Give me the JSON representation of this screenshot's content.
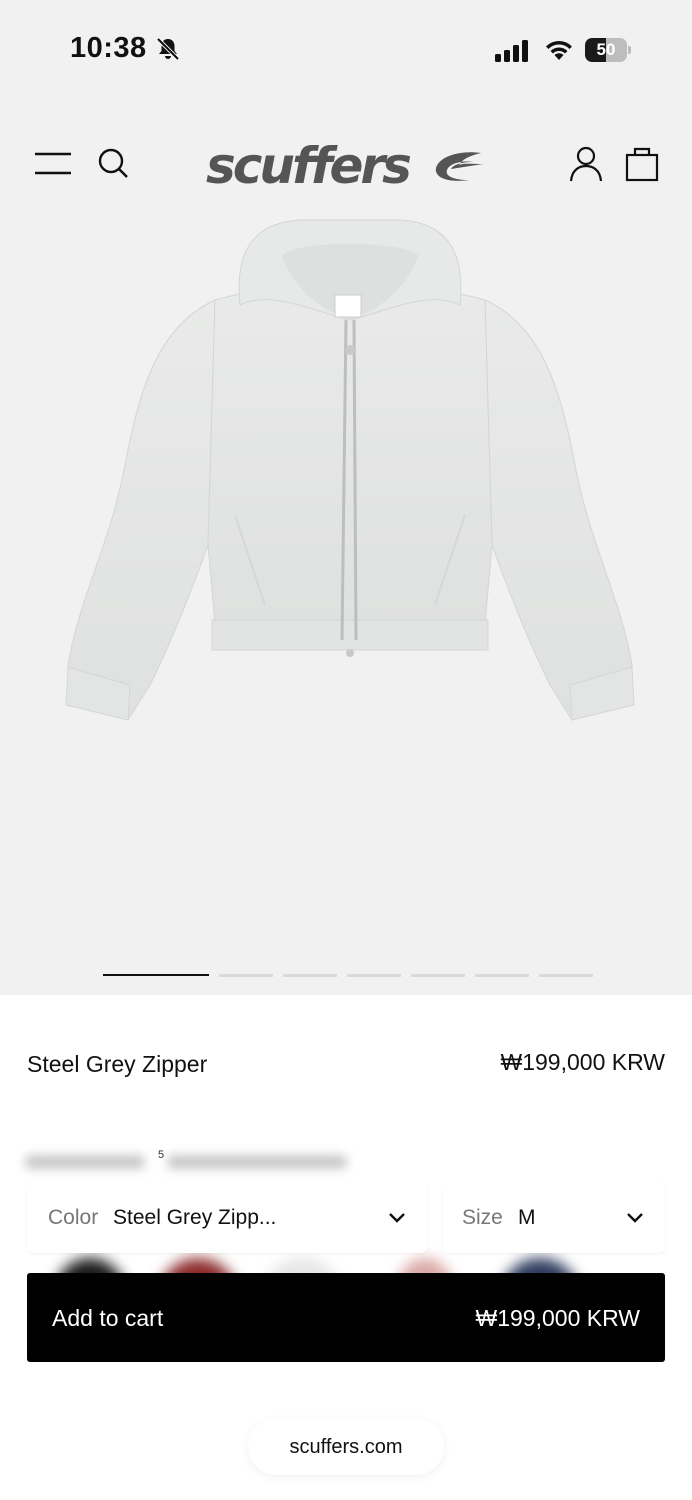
{
  "status_bar": {
    "time": "10:38",
    "battery_percent": "50",
    "battery_level": 0.5,
    "icons": [
      "bell-slash-icon",
      "signal-icon",
      "wifi-icon",
      "battery-icon"
    ]
  },
  "header": {
    "brand": "scuffers",
    "icons": [
      "hamburger-menu-icon",
      "search-icon",
      "user-icon",
      "shopping-bag-icon"
    ]
  },
  "gallery": {
    "image": "hoodie-image",
    "slide_count": 7,
    "active_slide": 1
  },
  "product": {
    "name": "Steel Grey Zipper",
    "price": "₩199,000 KRW"
  },
  "color_select": {
    "label": "Color",
    "value": "Steel Grey Zipp..."
  },
  "size_select": {
    "label": "Size",
    "value": "M"
  },
  "cart_button": {
    "label": "Add to cart",
    "price": "₩199,000 KRW"
  },
  "url_pill": "scuffers.com",
  "colors": {
    "accent": "#000000",
    "panel": "#ffffff",
    "background": "#f1f1f1",
    "hoodie": "#e4e6e5"
  }
}
